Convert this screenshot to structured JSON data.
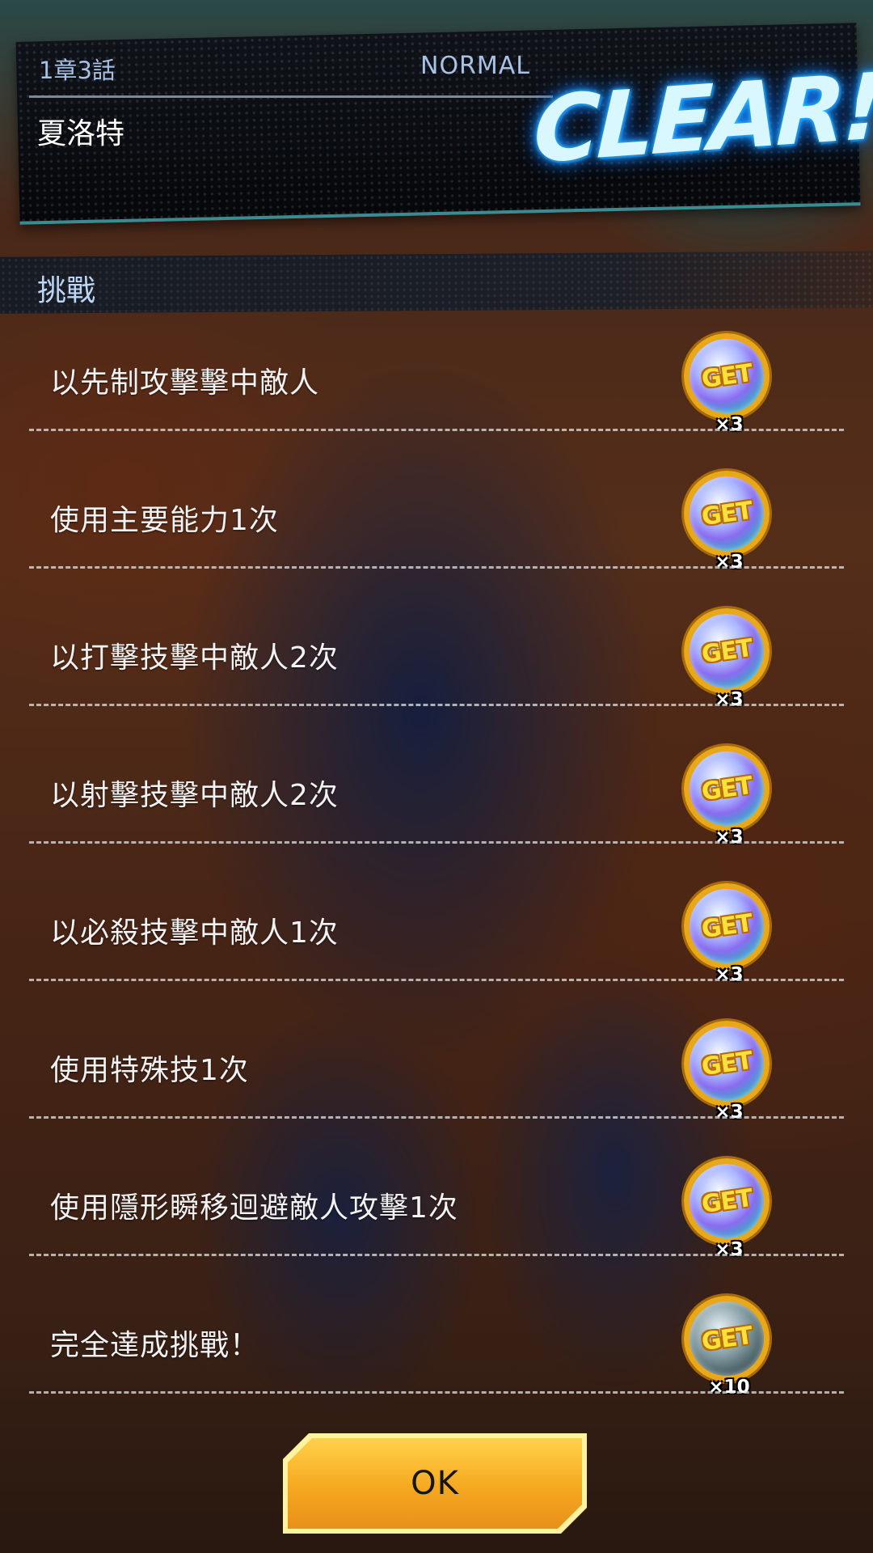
{
  "header": {
    "chapter": "1章3話",
    "difficulty": "NORMAL",
    "stage_name": "夏洛特",
    "result": "CLEAR!"
  },
  "challenges": {
    "title": "挑戰",
    "items": [
      {
        "text": "以先制攻擊擊中敵人",
        "reward_count": "×3",
        "reward_label": "GET",
        "reward_icon": "crystal-coin-icon"
      },
      {
        "text": "使用主要能力1次",
        "reward_count": "×3",
        "reward_label": "GET",
        "reward_icon": "crystal-coin-icon"
      },
      {
        "text": "以打擊技擊中敵人2次",
        "reward_count": "×3",
        "reward_label": "GET",
        "reward_icon": "crystal-coin-icon"
      },
      {
        "text": "以射擊技擊中敵人2次",
        "reward_count": "×3",
        "reward_label": "GET",
        "reward_icon": "crystal-coin-icon"
      },
      {
        "text": "以必殺技擊中敵人1次",
        "reward_count": "×3",
        "reward_label": "GET",
        "reward_icon": "crystal-coin-icon"
      },
      {
        "text": "使用特殊技1次",
        "reward_count": "×3",
        "reward_label": "GET",
        "reward_icon": "crystal-coin-icon"
      },
      {
        "text": "使用隱形瞬移迴避敵人攻擊1次",
        "reward_count": "×3",
        "reward_label": "GET",
        "reward_icon": "crystal-coin-icon"
      },
      {
        "text": "完全達成挑戰！",
        "reward_count": "×10",
        "reward_label": "GET",
        "reward_icon": "special-medal-icon"
      }
    ]
  },
  "ok_button": {
    "label": "OK"
  },
  "colors": {
    "accent_gold": "#f5a820",
    "clear_glow": "#1e9cff",
    "label_blue": "#a8c2e6"
  }
}
